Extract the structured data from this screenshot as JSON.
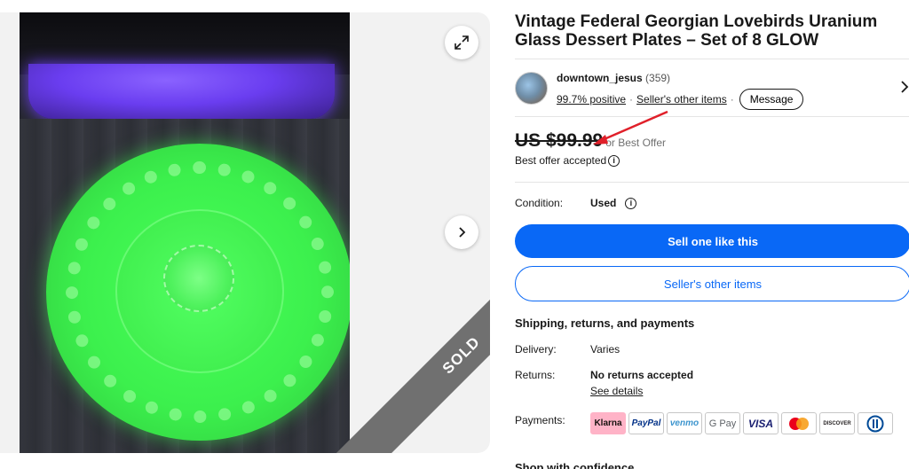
{
  "gallery": {
    "sold_label": "SOLD",
    "expand_icon": "expand-icon",
    "next_icon": "chevron-right-icon"
  },
  "listing": {
    "title": "Vintage Federal Georgian Lovebirds Uranium Glass Dessert Plates – Set of 8 GLOW"
  },
  "seller": {
    "name": "downtown_jesus",
    "feedback_count": "(359)",
    "positive": "99.7% positive",
    "dot": "·",
    "other_items": "Seller's other items",
    "message_button": "Message"
  },
  "price": {
    "amount": "US $99.99",
    "or_best_offer": "or Best Offer",
    "offer_status": "Best offer accepted"
  },
  "condition": {
    "label": "Condition:",
    "value": "Used"
  },
  "buttons": {
    "sell_one": "Sell one like this",
    "sellers_other_items": "Seller's other items"
  },
  "shipping": {
    "heading": "Shipping, returns, and payments",
    "delivery_label": "Delivery:",
    "delivery_value": "Varies",
    "returns_label": "Returns:",
    "returns_value": "No returns accepted",
    "see_details": "See details",
    "payments_label": "Payments:",
    "methods": [
      "Klarna",
      "PayPal",
      "venmo",
      "G Pay",
      "VISA",
      "",
      "DISCOVER",
      ""
    ]
  },
  "shop_confidence": "Shop with confidence",
  "colors": {
    "accent": "#0968f6",
    "sold_band": "#707070",
    "arrow": "#e0202a"
  }
}
